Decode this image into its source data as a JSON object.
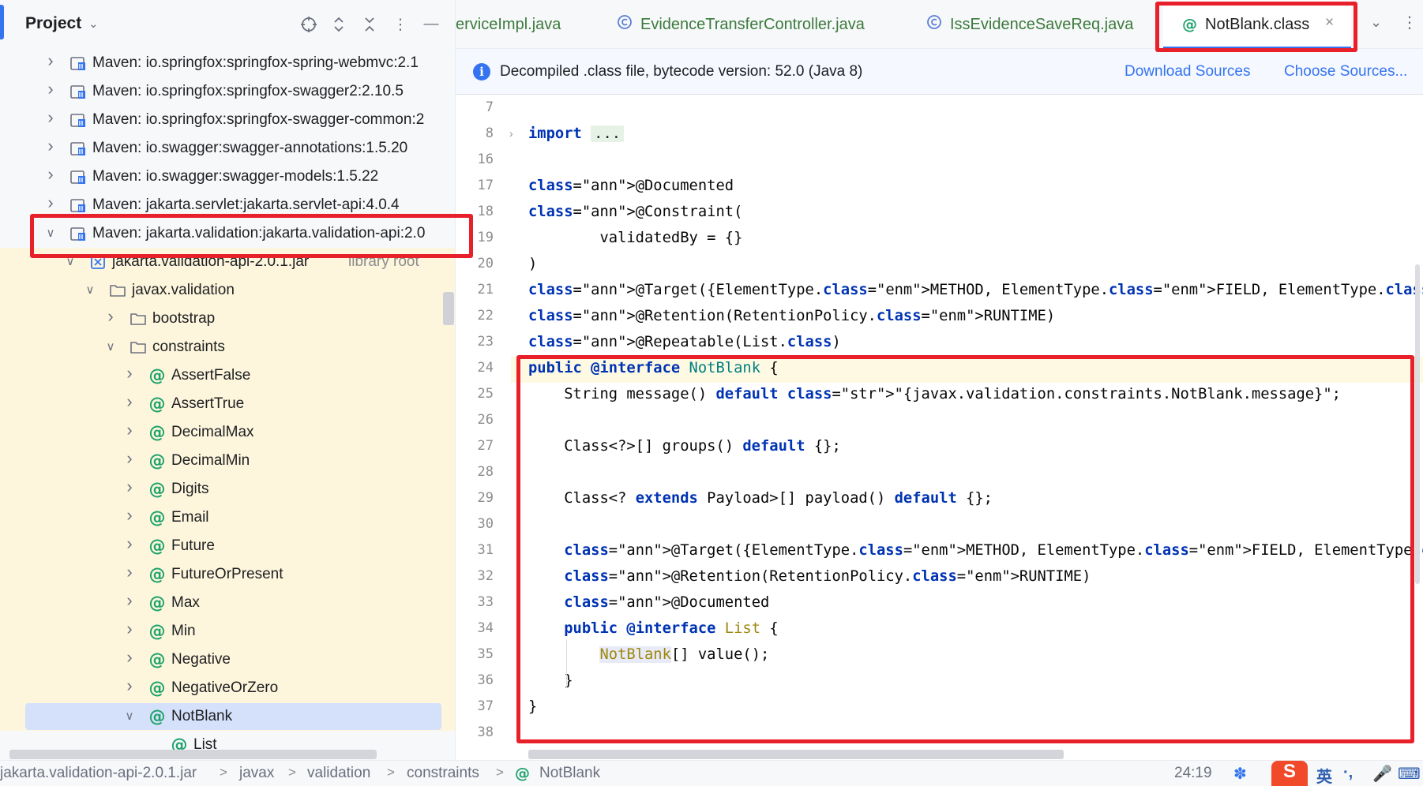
{
  "project_panel": {
    "title": "Project",
    "title_chevron": "chevron-down-icon",
    "header_icons": [
      "locate-icon",
      "expand-all-icon",
      "collapse-all-icon",
      "more-icon",
      "minimize-icon"
    ]
  },
  "tree": [
    {
      "label": "Maven: io.springfox:springfox-spring-webmvc:2.1",
      "type": "library"
    },
    {
      "label": "Maven: io.springfox:springfox-swagger2:2.10.5",
      "type": "library"
    },
    {
      "label": "Maven: io.springfox:springfox-swagger-common:2",
      "type": "library"
    },
    {
      "label": "Maven: io.swagger:swagger-annotations:1.5.20",
      "type": "library"
    },
    {
      "label": "Maven: io.swagger:swagger-models:1.5.22",
      "type": "library"
    },
    {
      "label": "Maven: jakarta.servlet:jakarta.servlet-api:4.0.4",
      "type": "library"
    },
    {
      "label": "Maven: jakarta.validation:jakarta.validation-api:2.0",
      "type": "library"
    },
    {
      "label": "jakarta.validation-api-2.0.1.jar",
      "suffix": "library root",
      "type": "jar"
    },
    {
      "label": "javax.validation",
      "type": "package"
    },
    {
      "label": "bootstrap",
      "type": "folder"
    },
    {
      "label": "constraints",
      "type": "folder"
    },
    {
      "label": "AssertFalse",
      "type": "annotation"
    },
    {
      "label": "AssertTrue",
      "type": "annotation"
    },
    {
      "label": "DecimalMax",
      "type": "annotation"
    },
    {
      "label": "DecimalMin",
      "type": "annotation"
    },
    {
      "label": "Digits",
      "type": "annotation"
    },
    {
      "label": "Email",
      "type": "annotation"
    },
    {
      "label": "Future",
      "type": "annotation"
    },
    {
      "label": "FutureOrPresent",
      "type": "annotation"
    },
    {
      "label": "Max",
      "type": "annotation"
    },
    {
      "label": "Min",
      "type": "annotation"
    },
    {
      "label": "Negative",
      "type": "annotation"
    },
    {
      "label": "NegativeOrZero",
      "type": "annotation"
    },
    {
      "label": "NotBlank",
      "type": "annotation"
    },
    {
      "label": "List",
      "type": "annotation"
    }
  ],
  "tabs": [
    {
      "label": "erviceImpl.java",
      "icon": "class-icon"
    },
    {
      "label": "EvidenceTransferController.java",
      "icon": "class-icon"
    },
    {
      "label": "IssEvidenceSaveReq.java",
      "icon": "class-icon"
    },
    {
      "label": "NotBlank.class",
      "icon": "annotation-icon",
      "active": true
    }
  ],
  "banner": {
    "text": "Decompiled .class file, bytecode version: 52.0 (Java 8)",
    "download_sources": "Download Sources",
    "choose_sources": "Choose Sources..."
  },
  "editor": {
    "line_numbers": [
      "7",
      "8",
      "16",
      "17",
      "18",
      "19",
      "20",
      "21",
      "22",
      "23",
      "24",
      "25",
      "26",
      "27",
      "28",
      "29",
      "30",
      "31",
      "32",
      "33",
      "34",
      "35",
      "36",
      "37",
      "38"
    ],
    "code_lines": [
      "",
      "import ...",
      "",
      "@Documented",
      "@Constraint(",
      "        validatedBy = {}",
      ")",
      "@Target({ElementType.METHOD, ElementType.FIELD, ElementType.ANNOTATION_TYPE, ElementType.CONSTRUCTOR, ElementType.PARAMETER, ElementType.TYPE_USE})",
      "@Retention(RetentionPolicy.RUNTIME)",
      "@Repeatable(List.class)",
      "public @interface NotBlank {",
      "    String message() default \"{javax.validation.constraints.NotBlank.message}\";",
      "",
      "    Class<?>[] groups() default {};",
      "",
      "    Class<? extends Payload>[] payload() default {};",
      "",
      "    @Target({ElementType.METHOD, ElementType.FIELD, ElementType.ANNOTATION_TYPE, ElementType.CONSTRUCTOR, ElementType.PARAMETER, ElementType.TYPE_USE})",
      "    @Retention(RetentionPolicy.RUNTIME)",
      "    @Documented",
      "    public @interface List {",
      "        NotBlank[] value();",
      "    }",
      "}",
      ""
    ]
  },
  "status": {
    "breadcrumbs": [
      "jakarta.validation-api-2.0.1.jar",
      "javax",
      "validation",
      "constraints",
      "NotBlank"
    ],
    "position": "24:19",
    "ime_lang": "英"
  }
}
